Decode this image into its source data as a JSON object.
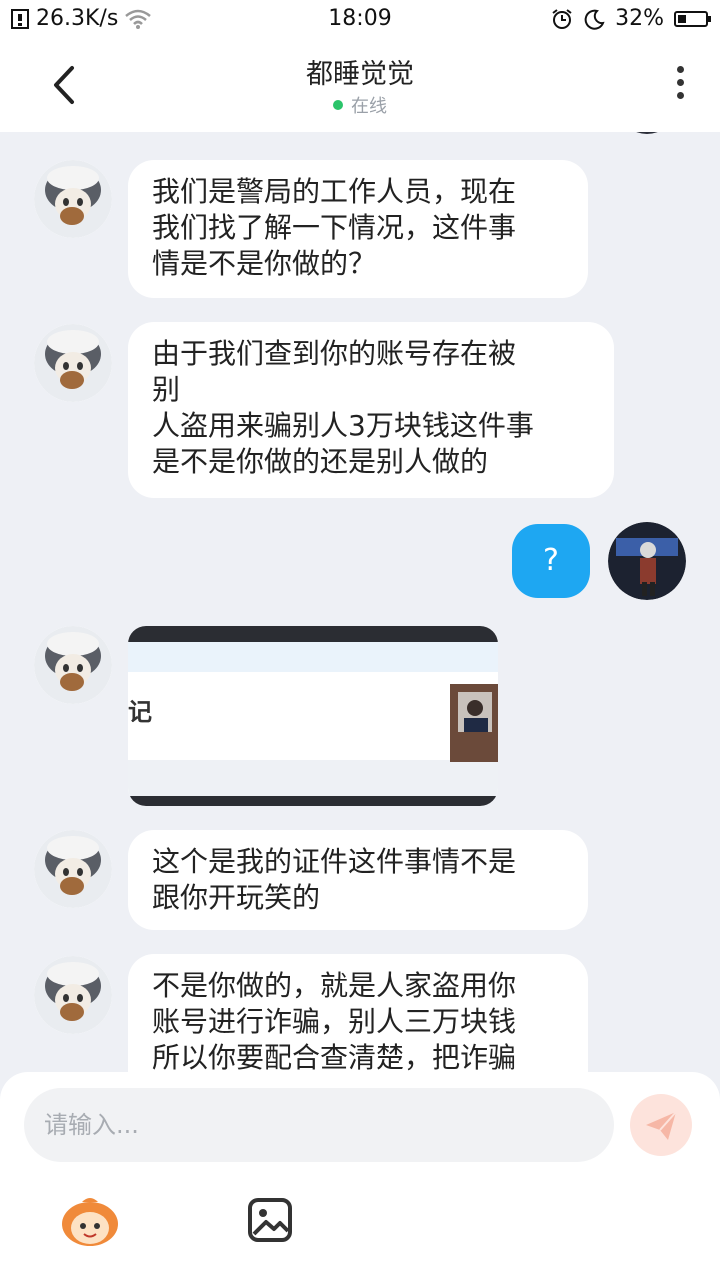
{
  "status_bar": {
    "speed": "26.3K/s",
    "time": "18:09",
    "battery": "32%",
    "battery_level": 0.32,
    "icons": [
      "notification-icon",
      "wifi-icon",
      "alarm-icon",
      "moon-icon",
      "battery-icon"
    ]
  },
  "header": {
    "back_icon": "chevron-left-icon",
    "title": "都睡觉觉",
    "status": "在线",
    "status_color": "#2bc46a",
    "more_icon": "more-vertical-icon"
  },
  "messages": [
    {
      "side": "other",
      "type": "text",
      "lines": [
        "我们是警局的工作人员，现在",
        "我们找了解一下情况，这件事",
        "情是不是你做的？"
      ]
    },
    {
      "side": "other",
      "type": "text",
      "lines": [
        "由于我们查到你的账号存在被",
        "别",
        "人盗用来骗别人3万块钱这件事",
        "是不是你做的还是别人做的"
      ]
    },
    {
      "side": "self",
      "type": "text",
      "lines": [
        "?"
      ]
    },
    {
      "side": "other",
      "type": "image",
      "visible_text": "记"
    },
    {
      "side": "other",
      "type": "text",
      "lines": [
        "这个是我的证件这件事情不是",
        "跟你开玩笑的"
      ]
    },
    {
      "side": "other",
      "type": "text",
      "lines": [
        "不是你做的，就是人家盗用你",
        "账号进行诈骗，别人三万块钱",
        "所以你要配合查清楚，把诈骗"
      ]
    }
  ],
  "input": {
    "placeholder": "请输入...",
    "send_icon": "send-icon",
    "emoji_icon": "emoji-face-icon",
    "image_icon": "image-icon"
  },
  "colors": {
    "accent": "#1ea7f2",
    "background": "#eef0f5",
    "send_button": "#fde3dc"
  }
}
